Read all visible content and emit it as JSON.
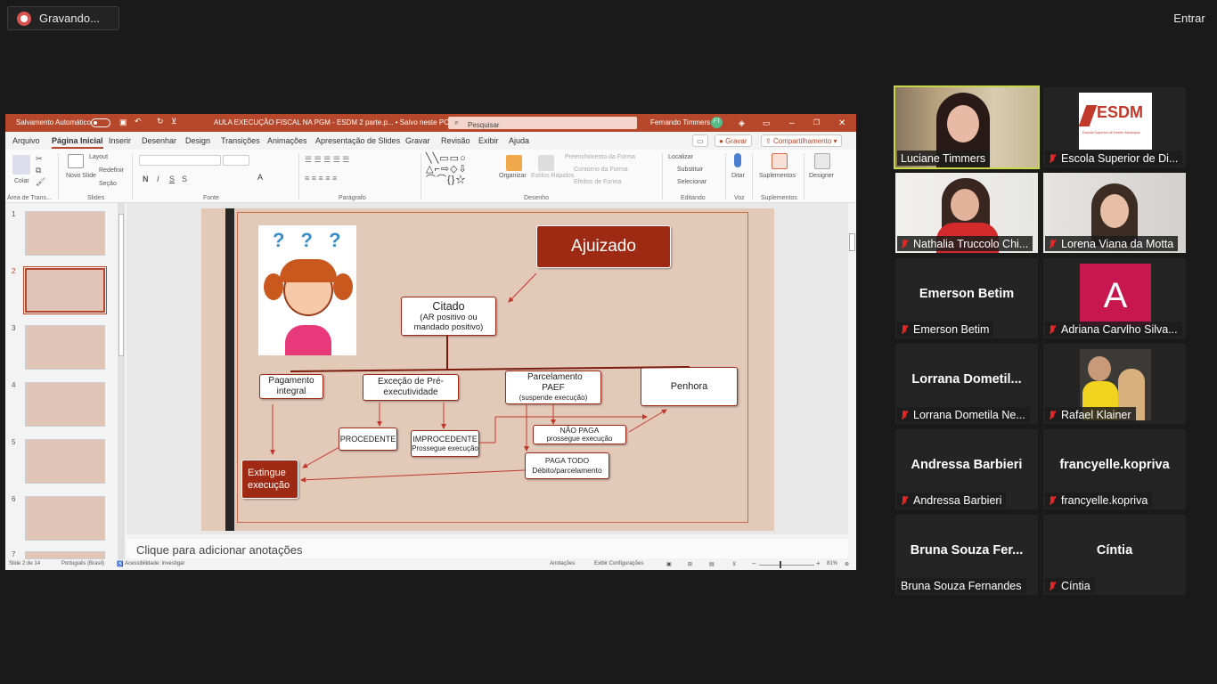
{
  "recording": {
    "label": "Gravando..."
  },
  "top": {
    "enter_label": "Entrar"
  },
  "ppt": {
    "autosave_label": "Salvamento Automático",
    "doc_title": "AULA EXECUÇÃO FISCAL NA PGM - ESDM 2 parte.p... • Salvo neste PC",
    "search_placeholder": "Pesquisar",
    "user_name": "Fernando Timmers",
    "user_initials": "FT",
    "menu": [
      "Arquivo",
      "Página Inicial",
      "Inserir",
      "Desenhar",
      "Design",
      "Transições",
      "Animações",
      "Apresentação de Slides",
      "Gravar",
      "Revisão",
      "Exibir",
      "Ajuda"
    ],
    "record_btn": "Gravar",
    "share_btn": "Compartilhamento",
    "ribbon": {
      "paste": "Colar",
      "clipboard": "Área de Trans...",
      "layout": "Layout",
      "reset": "Redefinir",
      "section": "Seção",
      "new_slide": "Novo Slide",
      "slides": "Slides",
      "font": "Fonte",
      "paragraph": "Parágrafo",
      "shape_fill": "Preenchimento da Forma",
      "shape_outline": "Contorno da Forma",
      "shape_effects": "Efeitos de Forma",
      "arrange": "Organizar",
      "quick_styles": "Estilos Rápidos",
      "drawing": "Desenho",
      "find": "Localizar",
      "replace": "Substituir",
      "select": "Selecionar",
      "editing": "Editando",
      "dictate": "Ditar",
      "voice": "Voz",
      "addins": "Suplementos",
      "addins_group": "Suplementos",
      "designer": "Designer"
    },
    "thumb_numbers": [
      "1",
      "2",
      "3",
      "4",
      "5",
      "6",
      "7"
    ],
    "notes_placeholder": "Clique para adicionar anotações",
    "status": {
      "slide": "Slide 2 de 14",
      "lang": "Português (Brasil)",
      "access": "Acessibilidade: investigar",
      "notes": "Anotações",
      "display": "Exibir Configurações",
      "zoom": "81%"
    }
  },
  "slide": {
    "question_marks": "? ? ?",
    "ajuizado": "Ajuizado",
    "citado": "Citado",
    "citado_sub": "(AR positivo ou mandado positivo)",
    "pagamento": "Pagamento integral",
    "excecao": "Exceção de Pré-executividade",
    "parcelamento": "Parcelamento PAEF",
    "parcelamento_sub": "(suspende execução)",
    "penhora": "Penhora",
    "procedente": "PROCEDENTE",
    "improcedente": "IMPROCEDENTE",
    "improcedente_sub": "Prossegue execução",
    "nao_paga": "NÃO PAGA",
    "nao_paga_sub": "prossegue execução",
    "paga_todo": "PAGA TODO",
    "paga_todo_sub": "Débito/parcelamento",
    "extingue": "Extingue execução"
  },
  "participants": [
    {
      "name": "Luciane Timmers",
      "video": true,
      "speaking": true,
      "muted": false
    },
    {
      "name": "Escola Superior de Di...",
      "video": true,
      "muted": true,
      "logo": "ESDM",
      "logo_sub": "Escola Superior de Direito Municipal"
    },
    {
      "name": "Nathalia Truccolo Chi...",
      "video": true,
      "muted": true
    },
    {
      "name": "Lorena Viana da Motta",
      "video": true,
      "muted": true
    },
    {
      "name": "Emerson Betim",
      "big": "Emerson Betim",
      "muted": true
    },
    {
      "name": "Adriana Carvlho Silva...",
      "avatar_letter": "A",
      "muted": true
    },
    {
      "name": "Lorrana Dometila Ne...",
      "big": "Lorrana  Dometil...",
      "muted": true
    },
    {
      "name": "Rafael Klainer",
      "video": true,
      "muted": true
    },
    {
      "name": "Andressa Barbieri",
      "big": "Andressa Barbieri",
      "muted": true
    },
    {
      "name": "francyelle.kopriva",
      "big": "francyelle.kopriva",
      "muted": true
    },
    {
      "name": "Bruna Souza Fernandes",
      "big": "Bruna Souza Fer...",
      "muted": false
    },
    {
      "name": "Cíntia",
      "big": "Cíntia",
      "muted": true
    }
  ],
  "colors": {
    "ppt_accent": "#b7472a",
    "slide_bg": "#e3c9b8",
    "box_border": "#9b2a1a",
    "speaking": "#c6d84a",
    "avatar_pink": "#c8174f"
  }
}
